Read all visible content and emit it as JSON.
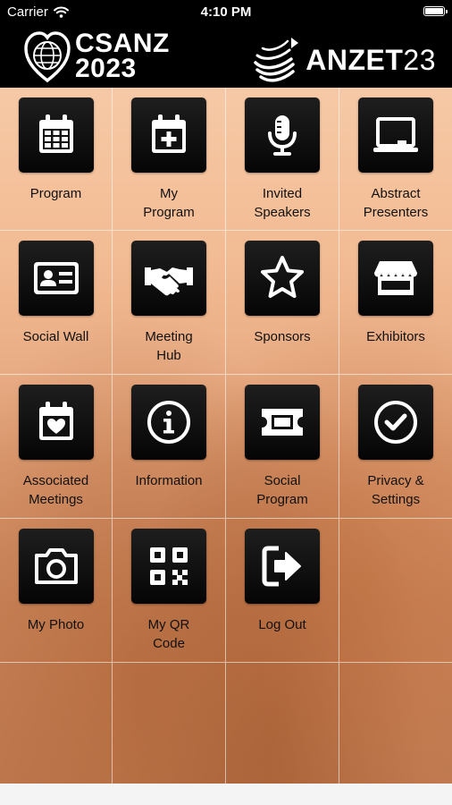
{
  "status_bar": {
    "carrier": "Carrier",
    "time": "4:10 PM"
  },
  "header": {
    "left_logo": {
      "name": "CSANZ",
      "year": "2023"
    },
    "right_logo": {
      "name": "ANZET",
      "year": "23"
    }
  },
  "menu": [
    {
      "label": "Program",
      "icon": "calendar-icon"
    },
    {
      "label": "My\nProgram",
      "icon": "calendar-plus-icon"
    },
    {
      "label": "Invited\nSpeakers",
      "icon": "microphone-icon"
    },
    {
      "label": "Abstract\nPresenters",
      "icon": "presentation-board-icon"
    },
    {
      "label": "Social Wall",
      "icon": "id-card-icon"
    },
    {
      "label": "Meeting\nHub",
      "icon": "handshake-icon"
    },
    {
      "label": "Sponsors",
      "icon": "star-icon"
    },
    {
      "label": "Exhibitors",
      "icon": "store-icon"
    },
    {
      "label": "Associated\nMeetings",
      "icon": "calendar-heart-icon"
    },
    {
      "label": "Information",
      "icon": "info-icon"
    },
    {
      "label": "Social\nProgram",
      "icon": "ticket-icon"
    },
    {
      "label": "Privacy &\nSettings",
      "icon": "check-circle-icon"
    },
    {
      "label": "My Photo",
      "icon": "camera-icon"
    },
    {
      "label": "My QR\nCode",
      "icon": "qr-code-icon"
    },
    {
      "label": "Log Out",
      "icon": "logout-icon"
    }
  ]
}
